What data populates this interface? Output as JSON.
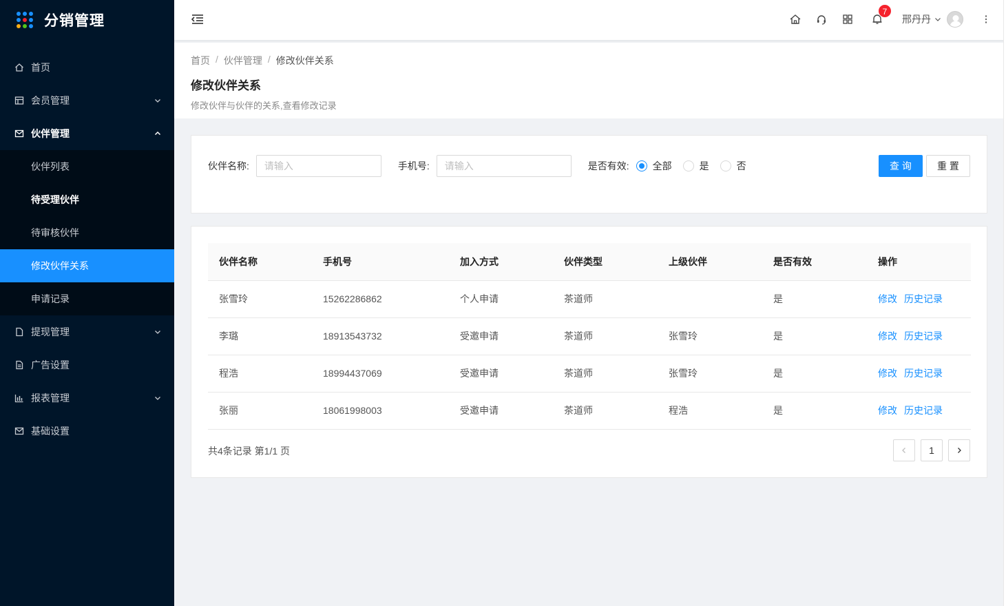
{
  "brand": {
    "title": "分销管理",
    "logo_colors": [
      "#1890ff",
      "#1890ff",
      "#1890ff",
      "#1890ff",
      "#f5222d",
      "#1890ff",
      "#faad14",
      "#52c41a",
      "#1890ff"
    ]
  },
  "sidebar": {
    "items": [
      {
        "label": "首页",
        "icon": "home-icon"
      },
      {
        "label": "会员管理",
        "icon": "table-icon",
        "arrow": "chevron-down-icon"
      },
      {
        "label": "伙伴管理",
        "icon": "mail-icon",
        "arrow": "chevron-up-icon"
      },
      {
        "label": "提现管理",
        "icon": "file-icon",
        "arrow": "chevron-down-icon"
      },
      {
        "label": "广告设置",
        "icon": "file-text-icon"
      },
      {
        "label": "报表管理",
        "icon": "bar-chart-icon",
        "arrow": "chevron-down-icon"
      },
      {
        "label": "基础设置",
        "icon": "mail-icon"
      }
    ],
    "partner_sub": [
      {
        "label": "伙伴列表"
      },
      {
        "label": "待受理伙伴"
      },
      {
        "label": "待审核伙伴"
      },
      {
        "label": "修改伙伴关系"
      },
      {
        "label": "申请记录"
      }
    ]
  },
  "header": {
    "notification_count": "7",
    "user_name": "邢丹丹",
    "icons": [
      "menu-fold-icon",
      "home-icon",
      "headset-icon",
      "apps-icon",
      "bell-icon",
      "more-vertical-icon"
    ]
  },
  "breadcrumb": {
    "home": "首页",
    "sep": "/",
    "parent": "伙伴管理",
    "current": "修改伙伴关系"
  },
  "page": {
    "title": "修改伙伴关系",
    "desc": "修改伙伴与伙伴的关系,查看修改记录"
  },
  "search": {
    "name_label": "伙伴名称:",
    "name_placeholder": "请输入",
    "phone_label": "手机号:",
    "phone_placeholder": "请输入",
    "valid_label": "是否有效:",
    "radio_all": "全部",
    "radio_yes": "是",
    "radio_no": "否",
    "selected": "全部",
    "query_btn": "查 询",
    "reset_btn": "重 置"
  },
  "table": {
    "columns": [
      "伙伴名称",
      "手机号",
      "加入方式",
      "伙伴类型",
      "上级伙伴",
      "是否有效",
      "操作"
    ],
    "rows": [
      {
        "name": "张雪玲",
        "phone": "15262286862",
        "join": "个人申请",
        "type": "茶道师",
        "parent": "",
        "valid": "是"
      },
      {
        "name": "李璐",
        "phone": "18913543732",
        "join": "受邀申请",
        "type": "茶道师",
        "parent": "张雪玲",
        "valid": "是"
      },
      {
        "name": "程浩",
        "phone": "18994437069",
        "join": "受邀申请",
        "type": "茶道师",
        "parent": "张雪玲",
        "valid": "是"
      },
      {
        "name": "张丽",
        "phone": "18061998003",
        "join": "受邀申请",
        "type": "茶道师",
        "parent": "程浩",
        "valid": "是"
      }
    ],
    "action_edit": "修改",
    "action_history": "历史记录"
  },
  "pagination": {
    "total_text": "共4条记录 第1/1 页",
    "current_page": "1",
    "prev_icon": "chevron-left-icon",
    "next_icon": "chevron-right-icon"
  },
  "colors": {
    "sidebar_bg": "#001529",
    "submenu_bg": "#000c17",
    "accent": "#1890ff",
    "badge": "#f5222d"
  }
}
